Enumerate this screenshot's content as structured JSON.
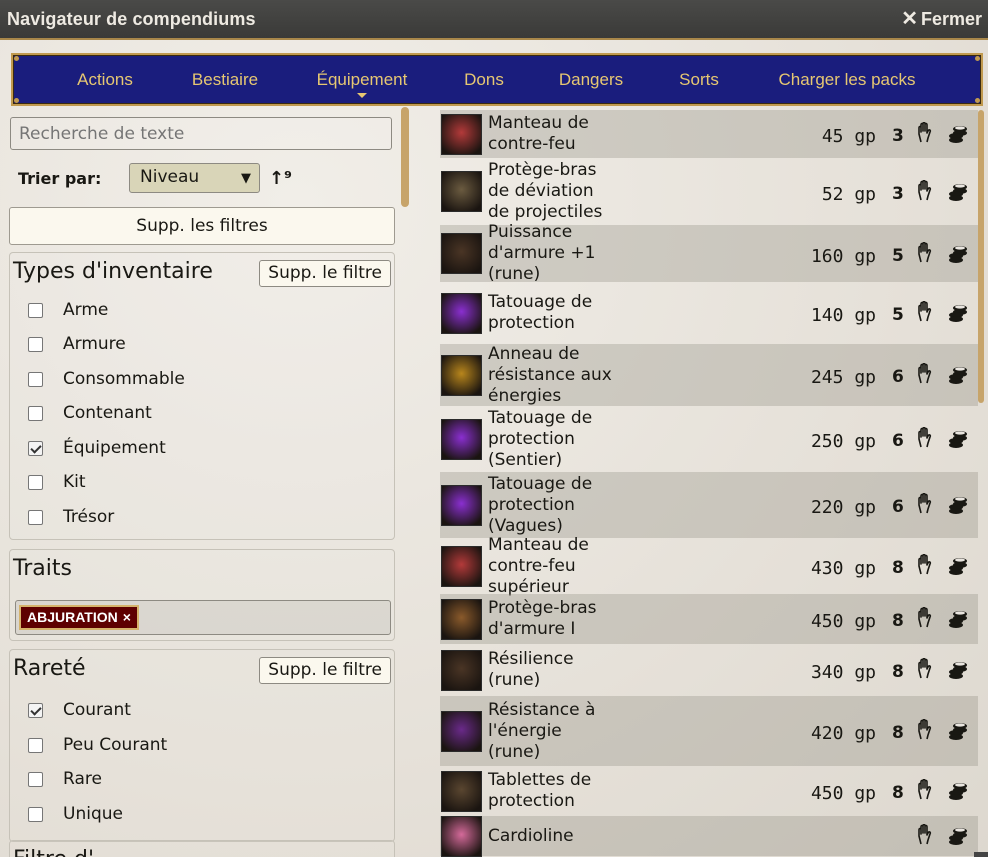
{
  "window": {
    "title": "Navigateur de compendiums",
    "close_label": "Fermer"
  },
  "nav": {
    "tabs": [
      {
        "label": "Actions",
        "active": false
      },
      {
        "label": "Bestiaire",
        "active": false
      },
      {
        "label": "Équipement",
        "active": true
      },
      {
        "label": "Dons",
        "active": false
      },
      {
        "label": "Dangers",
        "active": false
      },
      {
        "label": "Sorts",
        "active": false
      },
      {
        "label": "Charger les packs",
        "active": false
      }
    ]
  },
  "filters": {
    "search_placeholder": "Recherche de texte",
    "sort_label": "Trier par:",
    "sort_value": "Niveau",
    "sort_direction_icon": "sort-ascending-icon",
    "clear_all_label": "Supp. les filtres",
    "inventory": {
      "legend": "Types d'inventaire",
      "clear_label": "Supp. le filtre",
      "options": [
        {
          "label": "Arme",
          "checked": false
        },
        {
          "label": "Armure",
          "checked": false
        },
        {
          "label": "Consommable",
          "checked": false
        },
        {
          "label": "Contenant",
          "checked": false
        },
        {
          "label": "Équipement",
          "checked": true
        },
        {
          "label": "Kit",
          "checked": false
        },
        {
          "label": "Trésor",
          "checked": false
        }
      ]
    },
    "traits": {
      "legend": "Traits",
      "selected": [
        {
          "label": "ABJURATION",
          "remove": "×"
        }
      ]
    },
    "rarity": {
      "legend": "Rareté",
      "clear_label": "Supp. le filtre",
      "options": [
        {
          "label": "Courant",
          "checked": true
        },
        {
          "label": "Peu Courant",
          "checked": false
        },
        {
          "label": "Rare",
          "checked": false
        },
        {
          "label": "Unique",
          "checked": false
        }
      ]
    },
    "next_legend": "Filtre d'"
  },
  "results": [
    {
      "name_lines": [
        "Manteau de",
        "contre-feu"
      ],
      "price": "45 gp",
      "level": "3",
      "icon": "cloak-icon",
      "color": "#b33a3a"
    },
    {
      "name_lines": [
        "Protège-bras",
        "de déviation",
        "de projectiles"
      ],
      "price": "52 gp",
      "level": "3",
      "icon": "bracers-icon",
      "color": "#6b5b40"
    },
    {
      "name_lines": [
        "Puissance",
        "d'armure +1",
        "(rune)"
      ],
      "price": "160 gp",
      "level": "5",
      "icon": "rune-icon",
      "color": "#4a3525"
    },
    {
      "name_lines": [
        "Tatouage de",
        "protection"
      ],
      "price": "140 gp",
      "level": "5",
      "icon": "tattoo-icon",
      "color": "#8a2fd0"
    },
    {
      "name_lines": [
        "Anneau de",
        "résistance aux",
        "énergies"
      ],
      "price": "245 gp",
      "level": "6",
      "icon": "ring-icon",
      "color": "#b8861c"
    },
    {
      "name_lines": [
        "Tatouage de",
        "protection",
        "(Sentier)"
      ],
      "price": "250 gp",
      "level": "6",
      "icon": "tattoo-icon",
      "color": "#8a2fd0"
    },
    {
      "name_lines": [
        "Tatouage de",
        "protection",
        "(Vagues)"
      ],
      "price": "220 gp",
      "level": "6",
      "icon": "tattoo-icon",
      "color": "#8a2fd0"
    },
    {
      "name_lines": [
        "Manteau de",
        "contre-feu",
        "supérieur"
      ],
      "price": "430 gp",
      "level": "8",
      "icon": "cloak-icon",
      "color": "#b33a3a"
    },
    {
      "name_lines": [
        "Protège-bras",
        "d'armure I"
      ],
      "price": "450 gp",
      "level": "8",
      "icon": "bracers-icon",
      "color": "#8a5a2b"
    },
    {
      "name_lines": [
        "Résilience",
        "(rune)"
      ],
      "price": "340 gp",
      "level": "8",
      "icon": "rune-icon",
      "color": "#4a3525"
    },
    {
      "name_lines": [
        "Résistance à",
        "l'énergie",
        "(rune)"
      ],
      "price": "420 gp",
      "level": "8",
      "icon": "rune-icon",
      "color": "#6a2a8a"
    },
    {
      "name_lines": [
        "Tablettes de",
        "protection"
      ],
      "price": "450 gp",
      "level": "8",
      "icon": "tablet-icon",
      "color": "#5a4630"
    },
    {
      "name_lines": [
        "Cardioline"
      ],
      "price": "",
      "level": "",
      "icon": "gem-icon",
      "color": "#d46a9a"
    }
  ],
  "row_actions": {
    "hand_icon": "hand-icon",
    "coins_icon": "coins-icon"
  },
  "colors": {
    "nav_bg": "#1a1d7d",
    "nav_text": "#e6c772",
    "gold_border": "#c19a4f",
    "trait_bg": "#5e0000"
  }
}
